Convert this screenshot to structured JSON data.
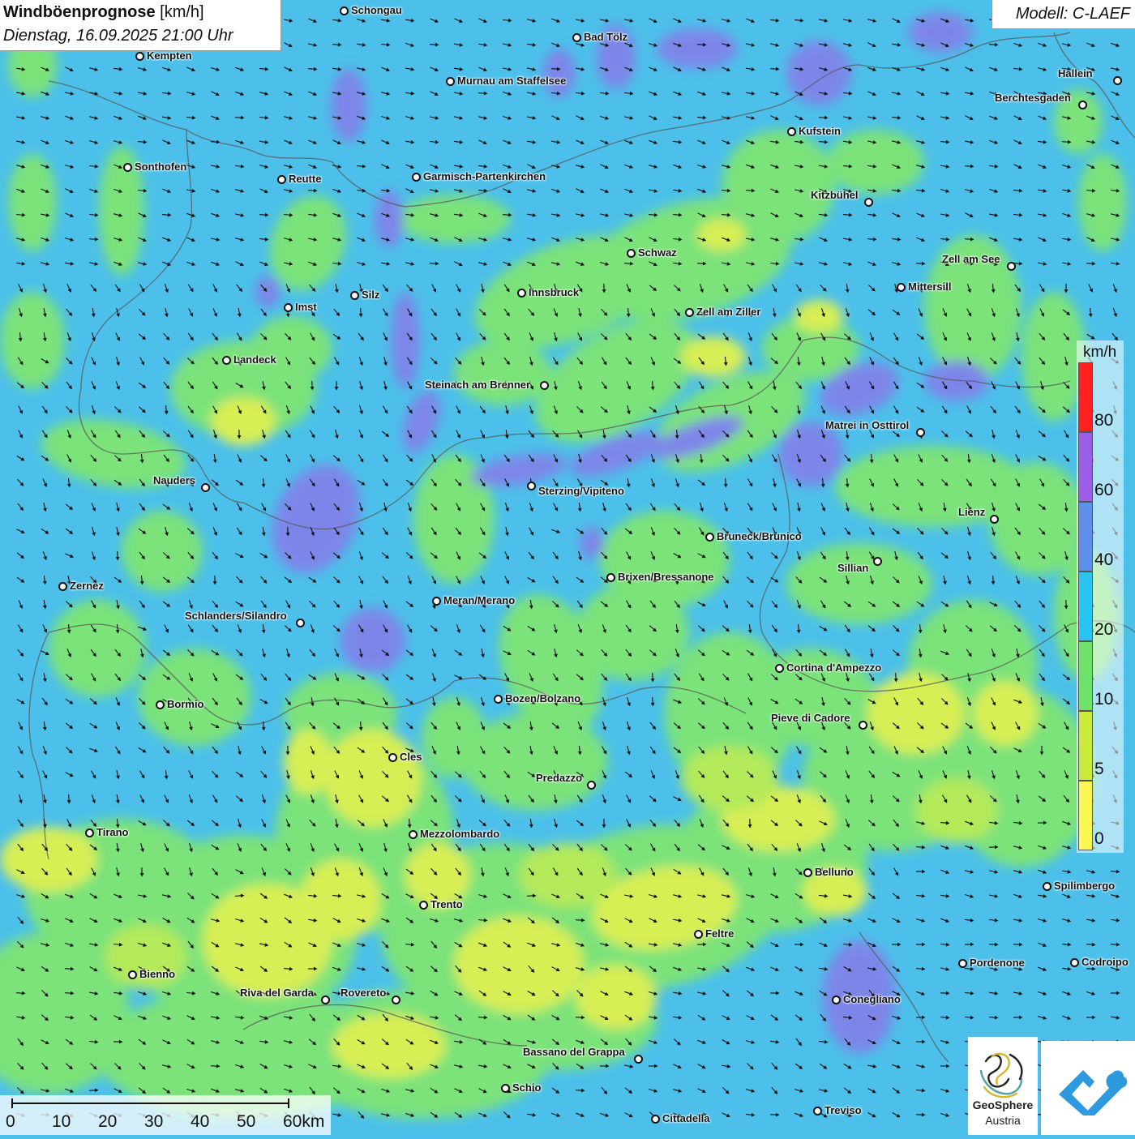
{
  "title": {
    "main": "Windböenprognose",
    "unit": " [km/h]",
    "datetime": "Dienstag, 16.09.2025 21:00 Uhr"
  },
  "model": "Modell: C-LAEF",
  "legend": {
    "unit": "km/h",
    "labels": [
      "80",
      "60",
      "40",
      "20",
      "10",
      "5",
      "0"
    ],
    "colors": [
      "#ff2020",
      "#9a5ee8",
      "#5d90ea",
      "#2ac4f0",
      "#6ee36a",
      "#c9ec3c",
      "#fbf752"
    ]
  },
  "scalebar": {
    "labels": [
      "0",
      "10",
      "20",
      "30",
      "40",
      "50",
      "60km"
    ]
  },
  "logo": {
    "name1": "GeoSphere",
    "name2": "Austria"
  },
  "cities": [
    {
      "name": "Schongau"
    },
    {
      "name": "Bad Tölz"
    },
    {
      "name": "Kempten"
    },
    {
      "name": "Murnau am Staffelsee"
    },
    {
      "name": "Hallein"
    },
    {
      "name": "Berchtesgaden"
    },
    {
      "name": "Kufstein"
    },
    {
      "name": "Sonthofen"
    },
    {
      "name": "Reutte"
    },
    {
      "name": "Garmisch-Partenkirchen"
    },
    {
      "name": "Kitzbühel"
    },
    {
      "name": "Schwaz"
    },
    {
      "name": "Zell am See"
    },
    {
      "name": "Innsbruck"
    },
    {
      "name": "Mittersill"
    },
    {
      "name": "Imst"
    },
    {
      "name": "Silz"
    },
    {
      "name": "Zell am Ziller"
    },
    {
      "name": "Landeck"
    },
    {
      "name": "Steinach am Brenner"
    },
    {
      "name": "Matrei in Osttirol"
    },
    {
      "name": "Nauders"
    },
    {
      "name": "Sterzing/Vipiteno"
    },
    {
      "name": "Lienz"
    },
    {
      "name": "Bruneck/Brunico"
    },
    {
      "name": "Sillian"
    },
    {
      "name": "Zernez"
    },
    {
      "name": "Brixen/Bressanone"
    },
    {
      "name": "Meran/Merano"
    },
    {
      "name": "Schlanders/Silandro"
    },
    {
      "name": "Cortina d'Ampezzo"
    },
    {
      "name": "Bormio"
    },
    {
      "name": "Bozen/Bolzano"
    },
    {
      "name": "Pieve di Cadore"
    },
    {
      "name": "Cles"
    },
    {
      "name": "Predazzo"
    },
    {
      "name": "Tirano"
    },
    {
      "name": "Mezzolombardo"
    },
    {
      "name": "Belluno"
    },
    {
      "name": "Spilimbergo"
    },
    {
      "name": "Trento"
    },
    {
      "name": "Feltre"
    },
    {
      "name": "Pordenone"
    },
    {
      "name": "Codroipo"
    },
    {
      "name": "Bienno"
    },
    {
      "name": "Riva del Garda"
    },
    {
      "name": "Rovereto"
    },
    {
      "name": "Conegliano"
    },
    {
      "name": "Bassano del Grappa"
    },
    {
      "name": "Schio"
    },
    {
      "name": "Treviso"
    },
    {
      "name": "Cittadella"
    }
  ]
}
